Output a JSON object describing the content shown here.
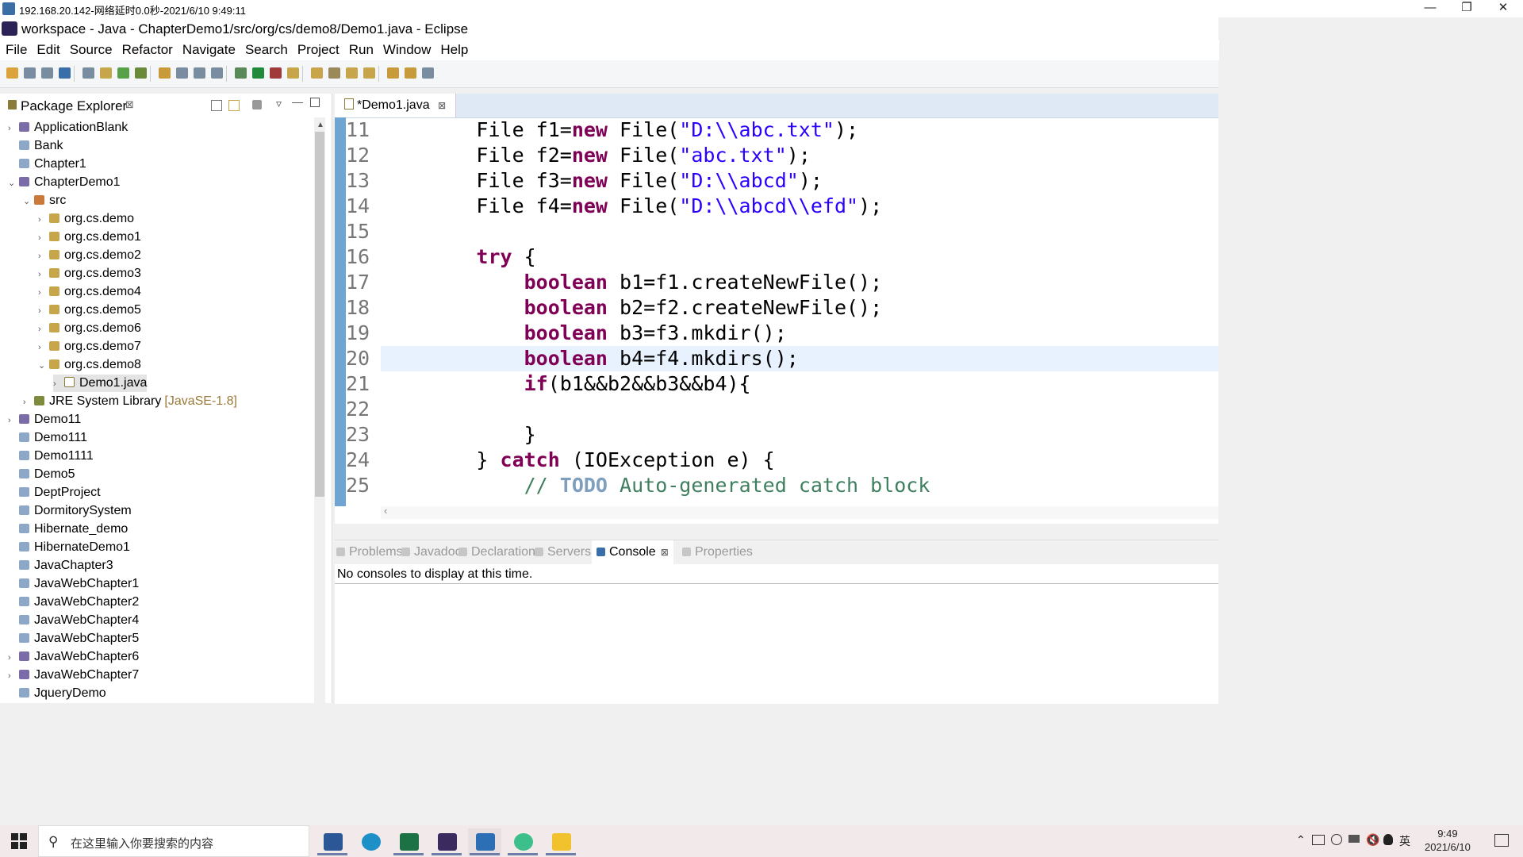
{
  "remote_bar": {
    "title": "192.168.20.142-网络延时0.0秒-2021/6/10 9:49:11"
  },
  "window": {
    "title": "workspace - Java - ChapterDemo1/src/org/cs/demo8/Demo1.java - Eclipse"
  },
  "menu": [
    "File",
    "Edit",
    "Source",
    "Refactor",
    "Navigate",
    "Search",
    "Project",
    "Run",
    "Window",
    "Help"
  ],
  "package_explorer": {
    "title": "Package Explorer",
    "close": "⊠",
    "items": [
      {
        "label": "ApplicationBlank",
        "icon": "project-java",
        "arrow": "›"
      },
      {
        "label": "Bank",
        "icon": "project",
        "arrow": ""
      },
      {
        "label": "Chapter1",
        "icon": "project",
        "arrow": ""
      },
      {
        "label": "ChapterDemo1",
        "icon": "project-java",
        "arrow": "⌄"
      },
      {
        "label": "src",
        "icon": "source-folder",
        "arrow": "⌄"
      },
      {
        "label": "org.cs.demo",
        "icon": "package",
        "arrow": "›"
      },
      {
        "label": "org.cs.demo1",
        "icon": "package",
        "arrow": "›"
      },
      {
        "label": "org.cs.demo2",
        "icon": "package",
        "arrow": "›"
      },
      {
        "label": "org.cs.demo3",
        "icon": "package",
        "arrow": "›"
      },
      {
        "label": "org.cs.demo4",
        "icon": "package",
        "arrow": "›"
      },
      {
        "label": "org.cs.demo5",
        "icon": "package",
        "arrow": "›"
      },
      {
        "label": "org.cs.demo6",
        "icon": "package",
        "arrow": "›"
      },
      {
        "label": "org.cs.demo7",
        "icon": "package",
        "arrow": "›"
      },
      {
        "label": "org.cs.demo8",
        "icon": "package",
        "arrow": "⌄"
      },
      {
        "label": "Demo1.java",
        "icon": "java-file",
        "arrow": "›"
      },
      {
        "label": "JRE System Library",
        "suffix": "[JavaSE-1.8]",
        "icon": "library",
        "arrow": "›"
      },
      {
        "label": "Demo11",
        "icon": "project-java",
        "arrow": "›"
      },
      {
        "label": "Demo111",
        "icon": "project",
        "arrow": ""
      },
      {
        "label": "Demo1111",
        "icon": "project",
        "arrow": ""
      },
      {
        "label": "Demo5",
        "icon": "project",
        "arrow": ""
      },
      {
        "label": "DeptProject",
        "icon": "project",
        "arrow": ""
      },
      {
        "label": "DormitorySystem",
        "icon": "project",
        "arrow": ""
      },
      {
        "label": "Hibernate_demo",
        "icon": "project",
        "arrow": ""
      },
      {
        "label": "HibernateDemo1",
        "icon": "project",
        "arrow": ""
      },
      {
        "label": "JavaChapter3",
        "icon": "project",
        "arrow": ""
      },
      {
        "label": "JavaWebChapter1",
        "icon": "project",
        "arrow": ""
      },
      {
        "label": "JavaWebChapter2",
        "icon": "project",
        "arrow": ""
      },
      {
        "label": "JavaWebChapter4",
        "icon": "project",
        "arrow": ""
      },
      {
        "label": "JavaWebChapter5",
        "icon": "project",
        "arrow": ""
      },
      {
        "label": "JavaWebChapter6",
        "icon": "project-java",
        "arrow": "›"
      },
      {
        "label": "JavaWebChapter7",
        "icon": "project-java",
        "arrow": "›"
      },
      {
        "label": "JqueryDemo",
        "icon": "project",
        "arrow": ""
      }
    ]
  },
  "editor": {
    "tab_label": "*Demo1.java",
    "tab_close": "⊠",
    "current_line": "20",
    "lines": [
      {
        "n": "11",
        "tokens": [
          [
            "p",
            "        File f1="
          ],
          [
            "kw",
            "new"
          ],
          [
            "p",
            " File("
          ],
          [
            "str",
            "\"D:\\\\abc.txt\""
          ],
          [
            "p",
            ");"
          ]
        ]
      },
      {
        "n": "12",
        "tokens": [
          [
            "p",
            "        File f2="
          ],
          [
            "kw",
            "new"
          ],
          [
            "p",
            " File("
          ],
          [
            "str",
            "\"abc.txt\""
          ],
          [
            "p",
            ");"
          ]
        ]
      },
      {
        "n": "13",
        "tokens": [
          [
            "p",
            "        File f3="
          ],
          [
            "kw",
            "new"
          ],
          [
            "p",
            " File("
          ],
          [
            "str",
            "\"D:\\\\abcd\""
          ],
          [
            "p",
            ");"
          ]
        ]
      },
      {
        "n": "14",
        "tokens": [
          [
            "p",
            "        File f4="
          ],
          [
            "kw",
            "new"
          ],
          [
            "p",
            " File("
          ],
          [
            "str",
            "\"D:\\\\abcd\\\\efd\""
          ],
          [
            "p",
            ");"
          ]
        ]
      },
      {
        "n": "15",
        "tokens": [
          [
            "p",
            ""
          ]
        ]
      },
      {
        "n": "16",
        "tokens": [
          [
            "p",
            "        "
          ],
          [
            "kw",
            "try"
          ],
          [
            "p",
            " {"
          ]
        ]
      },
      {
        "n": "17",
        "tokens": [
          [
            "p",
            "            "
          ],
          [
            "kw",
            "boolean"
          ],
          [
            "p",
            " b1=f1.createNewFile();"
          ]
        ]
      },
      {
        "n": "18",
        "tokens": [
          [
            "p",
            "            "
          ],
          [
            "kw",
            "boolean"
          ],
          [
            "p",
            " b2=f2.createNewFile();"
          ]
        ]
      },
      {
        "n": "19",
        "tokens": [
          [
            "p",
            "            "
          ],
          [
            "kw",
            "boolean"
          ],
          [
            "p",
            " b3=f3.mkdir();"
          ]
        ]
      },
      {
        "n": "20",
        "tokens": [
          [
            "p",
            "            "
          ],
          [
            "kw",
            "boolean"
          ],
          [
            "p",
            " b4=f4.mkdirs();"
          ]
        ]
      },
      {
        "n": "21",
        "tokens": [
          [
            "p",
            "            "
          ],
          [
            "kw",
            "if"
          ],
          [
            "p",
            "(b1&&b2&&b3&&b4){"
          ]
        ]
      },
      {
        "n": "22",
        "tokens": [
          [
            "p",
            ""
          ]
        ]
      },
      {
        "n": "23",
        "tokens": [
          [
            "p",
            "            }"
          ]
        ]
      },
      {
        "n": "24",
        "tokens": [
          [
            "p",
            "        } "
          ],
          [
            "kw",
            "catch"
          ],
          [
            "p",
            " (IOException e) {"
          ]
        ]
      },
      {
        "n": "25",
        "tokens": [
          [
            "p",
            "            "
          ],
          [
            "cm",
            "// "
          ],
          [
            "todo",
            "TODO"
          ],
          [
            "cm",
            " Auto-generated catch block"
          ]
        ]
      }
    ]
  },
  "bottom_views": {
    "tabs": [
      {
        "label": "Problems",
        "active": false
      },
      {
        "label": "Javadoc",
        "active": false
      },
      {
        "label": "Declaration",
        "active": false
      },
      {
        "label": "Servers",
        "active": false
      },
      {
        "label": "Console",
        "active": true
      },
      {
        "label": "Properties",
        "active": false
      }
    ],
    "console_close": "⊠",
    "console_message": "No consoles to display at this time."
  },
  "taskbar": {
    "search_placeholder": "在这里输入你要搜索的内容",
    "apps": [
      "word",
      "edge",
      "excel",
      "eclipse",
      "remote-desktop",
      "browser",
      "file-explorer"
    ],
    "ime": "英",
    "time": "9:49",
    "date": "2021/6/10"
  },
  "colors": {
    "keyword": "#7f0055",
    "string": "#2a00ff",
    "comment": "#3f7f5f",
    "current_line": "#e8f2fe"
  }
}
